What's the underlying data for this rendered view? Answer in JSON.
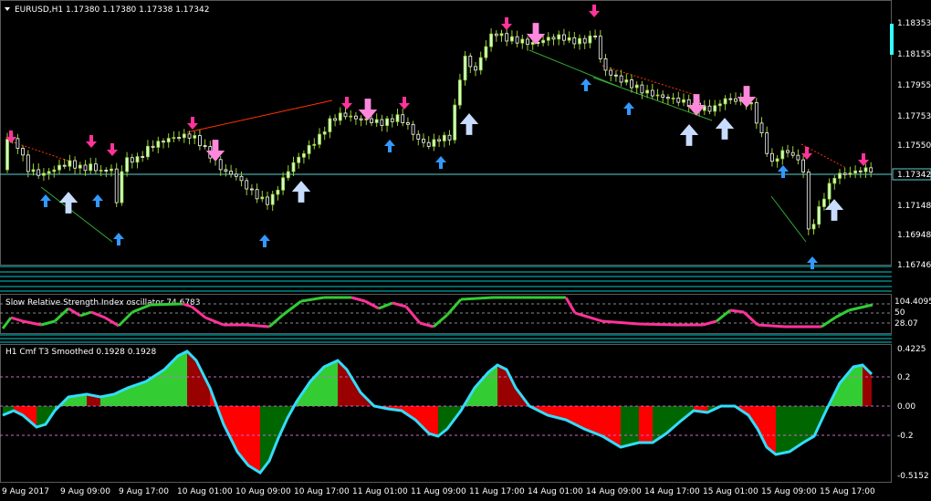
{
  "main": {
    "title": "EURUSD,H1  1.17380 1.17380 1.17338 1.17342",
    "price_ticks": [
      "1.18353",
      "1.18155",
      "1.17955",
      "1.17753",
      "1.17550",
      "1.17148",
      "1.16948",
      "1.16746"
    ],
    "current_price": "1.17342",
    "colors": {
      "bull": "#ccffcc",
      "bear": "#ffffff",
      "grid": "#00ffff",
      "up_arrow": "#3399ff",
      "down_arrow": "#ff3399",
      "big_up": "#c8dcff",
      "big_down": "#ff88dd",
      "trend_up": "#33aa33",
      "trend_down": "#ff3300"
    }
  },
  "rsi": {
    "title": "Slow Relative Strength Index oscillator 74.6783",
    "ticks": [
      "104.4095",
      "50",
      "28.07"
    ],
    "colors": {
      "rising": "#33cc33",
      "falling": "#ff3399"
    }
  },
  "cmf": {
    "title": "H1 Cmf T3 Smoothed 0.1928 0.1928",
    "ticks": [
      "0.4225",
      "0.2",
      "0.00",
      "-0.2",
      "-0.5152"
    ],
    "colors": {
      "pos_rise": "#33cc33",
      "pos_fall": "#990000",
      "neg_fall": "#ff0000",
      "neg_rise": "#006600",
      "line": "#33ddff",
      "level": "#cc66cc"
    }
  },
  "time_axis": {
    "labels": [
      "9 Aug 2017",
      "9 Aug 09:00",
      "9 Aug 17:00",
      "10 Aug 01:00",
      "10 Aug 09:00",
      "10 Aug 17:00",
      "11 Aug 01:00",
      "11 Aug 09:00",
      "11 Aug 17:00",
      "14 Aug 01:00",
      "14 Aug 09:00",
      "14 Aug 17:00",
      "15 Aug 01:00",
      "15 Aug 09:00",
      "15 Aug 17:00"
    ]
  },
  "icons": {
    "menu": "triangle-down-icon",
    "scroll": "scroll-marker-icon"
  }
}
